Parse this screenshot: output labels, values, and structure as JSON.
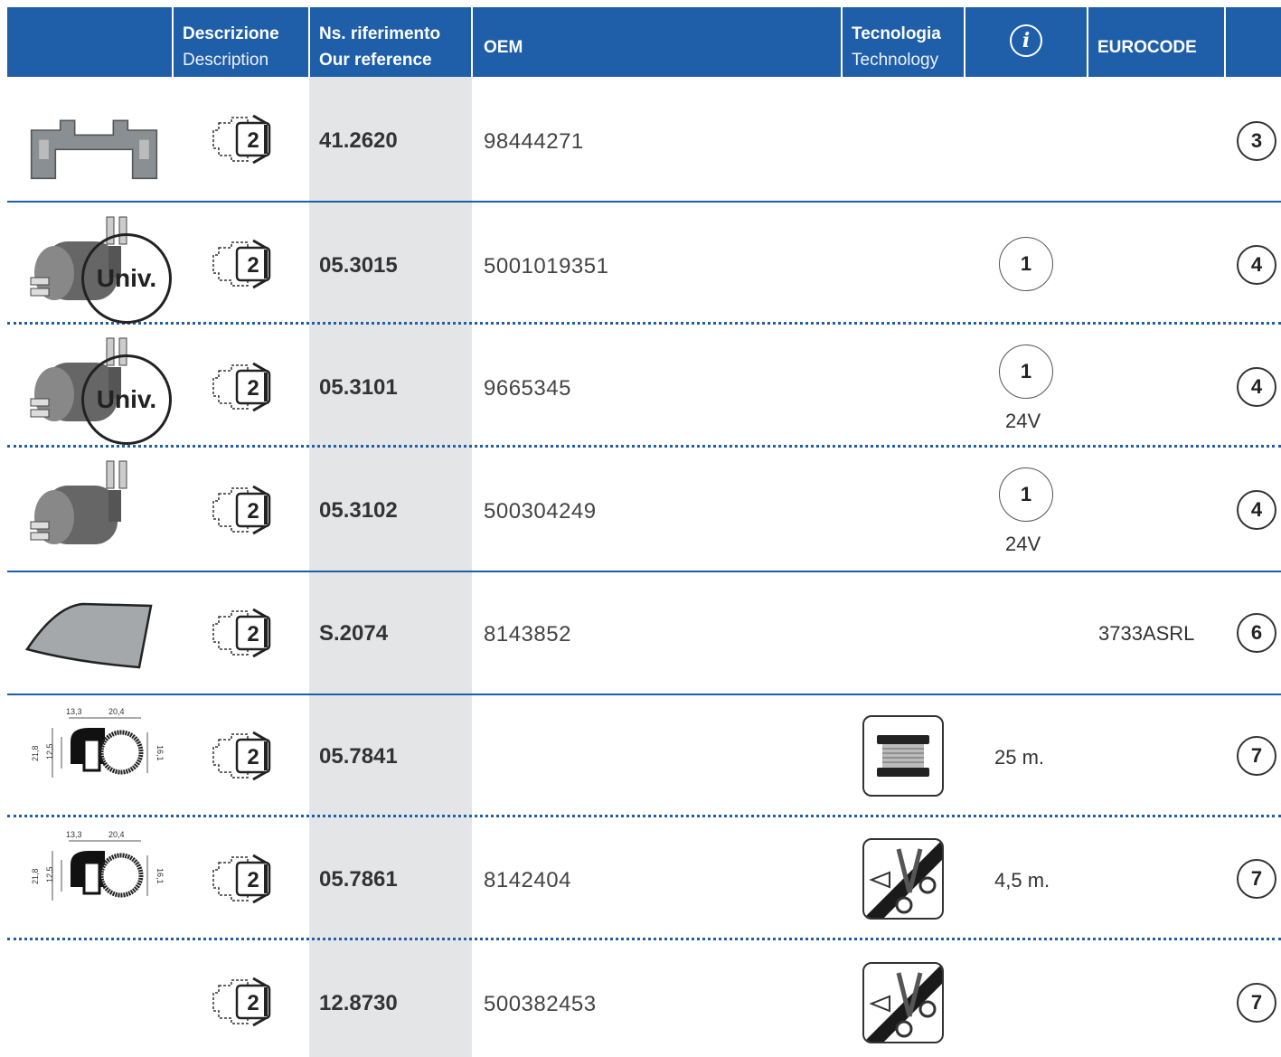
{
  "header": {
    "description_it": "Descrizione",
    "description_en": "Description",
    "reference_it": "Ns. riferimento",
    "reference_en": "Our reference",
    "oem": "OEM",
    "technology_it": "Tecnologia",
    "technology_en": "Technology",
    "info_icon": "i",
    "eurocode": "EUROCODE"
  },
  "colors": {
    "header_bg": "#1f5ea9",
    "ref_column_bg": "#e4e5e7"
  },
  "rows": [
    {
      "image": "bracket-clip",
      "pack_qty": "2",
      "ref": "41.2620",
      "oem": "98444271",
      "info": "",
      "info_note": "",
      "tech": "",
      "eurocode": "",
      "page": "3"
    },
    {
      "image": "washer-pump",
      "badge": "Univ.",
      "pack_qty": "2",
      "ref": "05.3015",
      "oem": "5001019351",
      "info": "1",
      "info_note": "",
      "tech": "",
      "eurocode": "",
      "page": "4"
    },
    {
      "image": "washer-pump",
      "badge": "Univ.",
      "pack_qty": "2",
      "ref": "05.3101",
      "oem": "9665345",
      "info": "1",
      "info_note": "24V",
      "tech": "",
      "eurocode": "",
      "page": "4"
    },
    {
      "image": "washer-pump",
      "pack_qty": "2",
      "ref": "05.3102",
      "oem": "500304249",
      "info": "1",
      "info_note": "24V",
      "tech": "",
      "eurocode": "",
      "page": "4"
    },
    {
      "image": "windscreen",
      "pack_qty": "2",
      "ref": "S.2074",
      "oem": "8143852",
      "info": "",
      "info_note": "",
      "tech": "",
      "eurocode": "3733ASRL",
      "page": "6"
    },
    {
      "image": "seal-profile",
      "dims": [
        "13,3",
        "20,4",
        "21,8",
        "12,5",
        "16,1"
      ],
      "pack_qty": "2",
      "ref": "05.7841",
      "oem": "",
      "info": "",
      "info_note": "25 m.",
      "tech": "reel-icon",
      "eurocode": "",
      "page": "7"
    },
    {
      "image": "seal-profile",
      "dims": [
        "13,3",
        "20,4",
        "21,8",
        "12,5",
        "16,1"
      ],
      "pack_qty": "2",
      "ref": "05.7861",
      "oem": "8142404",
      "info": "",
      "info_note": "4,5 m.",
      "tech": "scissors-icon",
      "eurocode": "",
      "page": "7"
    },
    {
      "image": "",
      "pack_qty": "2",
      "ref": "12.8730",
      "oem": "500382453",
      "info": "",
      "info_note": "",
      "tech": "scissors-icon",
      "eurocode": "",
      "page": "7"
    }
  ]
}
